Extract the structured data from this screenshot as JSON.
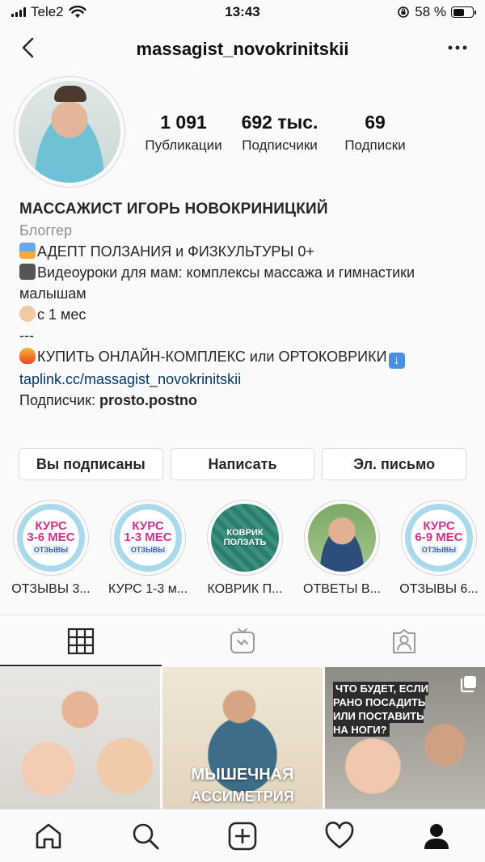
{
  "status_bar": {
    "carrier": "Tele2",
    "time": "13:43",
    "battery": "58 %",
    "battery_level": 0.58
  },
  "header": {
    "username": "massagist_novokrinitskii",
    "back_icon": "chevron-left-icon",
    "more_icon": "more-horizontal-icon"
  },
  "profile": {
    "stats": [
      {
        "value": "1 091",
        "label": "Публикации"
      },
      {
        "value": "692 тыс.",
        "label": "Подписчики"
      },
      {
        "value": "69",
        "label": "Подписки"
      }
    ],
    "name": "МАССАЖИСТ ИГОРЬ НОВОКРИНИЦКИЙ",
    "category": "Блоггер",
    "bio_lines": [
      "АДЕПТ ПОЛЗАНИЯ и ФИЗКУЛЬТУРЫ 0+",
      "Видеоуроки для мам: комплексы массажа и гимнастики малышам",
      "с 1 мес",
      "---",
      "КУПИТЬ ОНЛАЙН-КОМПЛЕКС или ОРТОКОВРИКИ"
    ],
    "link": "taplink.cc/massagist_novokrinitskii",
    "follower_prefix": "Подписчик: ",
    "follower_name": "prosto.postno"
  },
  "buttons": {
    "following": "Вы подписаны",
    "message": "Написать",
    "email": "Эл. письмо"
  },
  "highlights": [
    {
      "label": "ОТЗЫВЫ 3...",
      "title": "КУРС",
      "subtitle": "3-6 МЕС",
      "tag": "ОТЗЫВЫ"
    },
    {
      "label": "КУРС 1-3 м...",
      "title": "КУРС",
      "subtitle": "1-3 МЕС",
      "tag": "ОТЗЫВЫ"
    },
    {
      "label": "КОВРИК П...",
      "title": "КОВРИК",
      "subtitle": "ПОЛЗАТЬ"
    },
    {
      "label": "ОТВЕТЫ В..."
    },
    {
      "label": "ОТЗЫВЫ 6...",
      "title": "КУРС",
      "subtitle": "6-9 МЕС",
      "tag": "ОТЗЫВЫ"
    }
  ],
  "posts": {
    "post2_caption_1": "МЫШЕЧНАЯ",
    "post2_caption_2": "АССИМЕТРИЯ",
    "post3_caption": "ЧТО БУДЕТ, ЕСЛИ РАНО ПОСАДИТЬ ИЛИ ПОСТАВИТЬ НА НОГИ?"
  },
  "colors": {
    "link": "#00376b",
    "category": "#8e8e8e",
    "highlight_title": "#d2308e"
  }
}
